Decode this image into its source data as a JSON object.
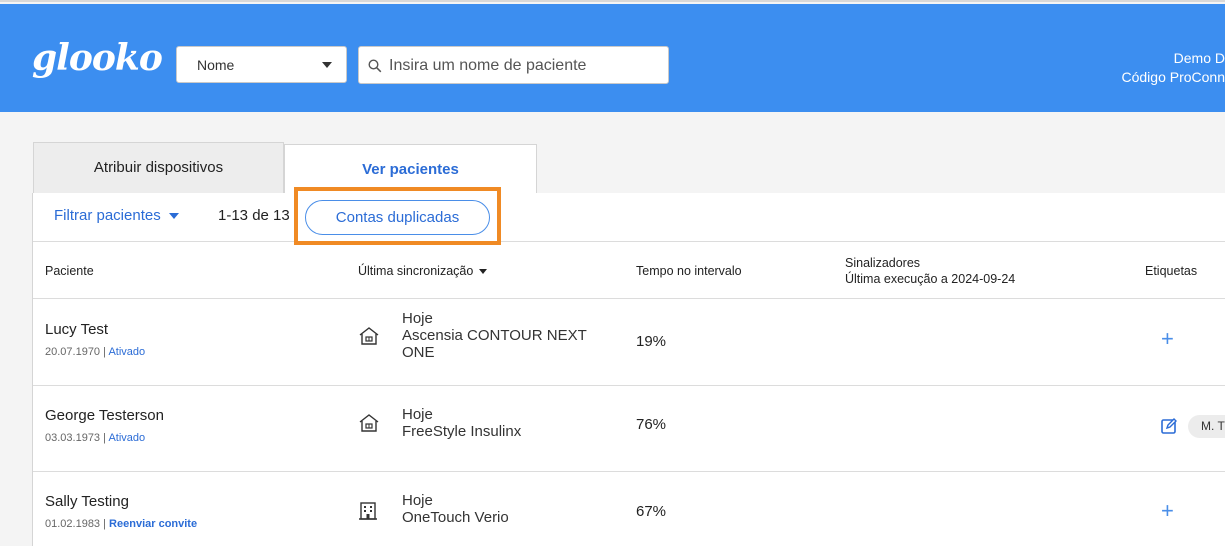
{
  "header": {
    "logo": "glooko",
    "search_type": "Nome",
    "search_placeholder": "Insira um nome de paciente",
    "user_line1": "Demo D",
    "user_line2": "Código ProConn"
  },
  "tabs": {
    "assign": "Atribuir dispositivos",
    "view": "Ver pacientes"
  },
  "filterbar": {
    "filter_label": "Filtrar pacientes",
    "count": "1-13 de 13",
    "duplicates_label": "Contas duplicadas"
  },
  "columns": {
    "patient": "Paciente",
    "last_sync": "Última sincronização",
    "time_in_range": "Tempo no intervalo",
    "flags_line1": "Sinalizadores",
    "flags_line2": "Última execução a 2024-09-24",
    "tags": "Etiquetas"
  },
  "rows": [
    {
      "name": "Lucy Test",
      "dob": "20.07.1970",
      "sep": " | ",
      "status": "Ativado",
      "sync_day": "Hoje",
      "device": "Ascensia CONTOUR NEXT ONE",
      "device_icon": "home-icon",
      "tir": "19%",
      "tag_action": "+"
    },
    {
      "name": "George Testerson",
      "dob": "03.03.1973",
      "sep": " | ",
      "status": "Ativado",
      "sync_day": "Hoje",
      "device": "FreeStyle Insulinx",
      "device_icon": "home-icon",
      "tir": "76%",
      "tag": "M. T"
    },
    {
      "name": "Sally Testing",
      "dob": "01.02.1983",
      "sep": " | ",
      "status": "Reenviar convite",
      "sync_day": "Hoje",
      "device": "OneTouch Verio",
      "device_icon": "building-icon",
      "tir": "67%",
      "tag_action": "+"
    }
  ],
  "colors": {
    "header_bg": "#3c8ef0",
    "link_blue": "#2b6cd6",
    "highlight_orange": "#f08a24"
  }
}
